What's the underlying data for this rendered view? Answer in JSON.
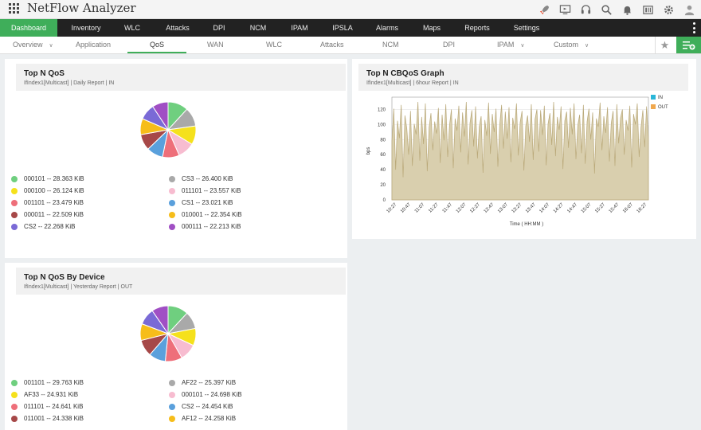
{
  "app": {
    "title": "NetFlow Analyzer"
  },
  "top_icons": [
    "rocket-icon",
    "monitor-icon",
    "headset-icon",
    "search-icon",
    "bell-icon",
    "license-icon",
    "gear-icon",
    "user-icon"
  ],
  "main_nav": [
    {
      "label": "Dashboard",
      "active": true
    },
    {
      "label": "Inventory"
    },
    {
      "label": "WLC"
    },
    {
      "label": "Attacks"
    },
    {
      "label": "DPI"
    },
    {
      "label": "NCM"
    },
    {
      "label": "IPAM"
    },
    {
      "label": "IPSLA"
    },
    {
      "label": "Alarms"
    },
    {
      "label": "Maps"
    },
    {
      "label": "Reports"
    },
    {
      "label": "Settings"
    }
  ],
  "sub_nav": [
    {
      "label": "Overview",
      "dropdown": true
    },
    {
      "label": "Application"
    },
    {
      "label": "QoS",
      "active": true
    },
    {
      "label": "WAN"
    },
    {
      "label": "WLC"
    },
    {
      "label": "Attacks"
    },
    {
      "label": "NCM"
    },
    {
      "label": "DPI"
    },
    {
      "label": "IPAM",
      "dropdown": true
    },
    {
      "label": "Custom",
      "dropdown": true
    }
  ],
  "widgets": {
    "top_qos": {
      "title": "Top N QoS",
      "subtitle": "IfIndex1[Multicast] | Daily Report | IN",
      "items": [
        {
          "label": "000101 -- 28.363 KiB",
          "value": 28.363,
          "color": "#6fcf7f"
        },
        {
          "label": "CS3 -- 26.400 KiB",
          "value": 26.4,
          "color": "#a9a9a9"
        },
        {
          "label": "000100 -- 26.124 KiB",
          "value": 26.124,
          "color": "#f5e11c"
        },
        {
          "label": "011101 -- 23.557 KiB",
          "value": 23.557,
          "color": "#f7bcd0"
        },
        {
          "label": "001101 -- 23.479 KiB",
          "value": 23.479,
          "color": "#ee6f7a"
        },
        {
          "label": "CS1 -- 23.021 KiB",
          "value": 23.021,
          "color": "#5aa0dc"
        },
        {
          "label": "000011 -- 22.509 KiB",
          "value": 22.509,
          "color": "#a64848"
        },
        {
          "label": "010001 -- 22.354 KiB",
          "value": 22.354,
          "color": "#f6bd1a"
        },
        {
          "label": "CS2 -- 22.268 KiB",
          "value": 22.268,
          "color": "#7a6ad6"
        },
        {
          "label": "000111 -- 22.213 KiB",
          "value": 22.213,
          "color": "#a04fc4"
        }
      ]
    },
    "top_qos_device": {
      "title": "Top N QoS By Device",
      "subtitle": "IfIndex1[Multicast] | Yesterday Report | OUT",
      "items": [
        {
          "label": "001101 -- 29.763 KiB",
          "value": 29.763,
          "color": "#6fcf7f"
        },
        {
          "label": "AF22 -- 25.397 KiB",
          "value": 25.397,
          "color": "#a9a9a9"
        },
        {
          "label": "AF33 -- 24.931 KiB",
          "value": 24.931,
          "color": "#f5e11c"
        },
        {
          "label": "000101 -- 24.698 KiB",
          "value": 24.698,
          "color": "#f7bcd0"
        },
        {
          "label": "011101 -- 24.641 KiB",
          "value": 24.641,
          "color": "#ee6f7a"
        },
        {
          "label": "CS2 -- 24.454 KiB",
          "value": 24.454,
          "color": "#5aa0dc"
        },
        {
          "label": "011001 -- 24.338 KiB",
          "value": 24.338,
          "color": "#a64848"
        },
        {
          "label": "AF12 -- 24.258 KiB",
          "value": 24.258,
          "color": "#f6bd1a"
        },
        {
          "label": "",
          "value": 24.2,
          "color": "#7a6ad6"
        },
        {
          "label": "",
          "value": 24.1,
          "color": "#a04fc4"
        }
      ]
    },
    "cbqos": {
      "title": "Top N CBQoS Graph",
      "subtitle": "IfIndex1[Multicast] | 6hour Report | IN"
    }
  },
  "chart_data": {
    "type": "area",
    "title": "Top N CBQoS Graph",
    "xlabel": "Time ( HH:MM )",
    "ylabel": "bps",
    "ylim": [
      0,
      130
    ],
    "yticks": [
      0,
      20,
      40,
      60,
      80,
      100,
      120
    ],
    "x_ticks": [
      "10:27",
      "10:47",
      "11:07",
      "11:27",
      "11:47",
      "12:07",
      "12:27",
      "12:47",
      "13:07",
      "13:27",
      "13:47",
      "14:07",
      "14:27",
      "14:47",
      "15:07",
      "15:27",
      "15:47",
      "16:07",
      "16:27"
    ],
    "legend": "top-right",
    "series": [
      {
        "name": "IN",
        "color": "#29b6d8",
        "values": []
      },
      {
        "name": "OUT",
        "color": "#f0a84e",
        "values": [
          78,
          121,
          40,
          105,
          82,
          126,
          30,
          112,
          95,
          60,
          118,
          45,
          101,
          87,
          130,
          52,
          110,
          74,
          128,
          38,
          96,
          115,
          66,
          104,
          88,
          122,
          49,
          113,
          79,
          127,
          57,
          99,
          120,
          42,
          108,
          92,
          125,
          63,
          116,
          84,
          130,
          47,
          102,
          119,
          71,
          124,
          55,
          97,
          111,
          36,
          106,
          85,
          129,
          61,
          114,
          90,
          121,
          44,
          100,
          126,
          68,
          117,
          81,
          123,
          50,
          109,
          94,
          128,
          59,
          103,
          118,
          39,
          98,
          112,
          77,
          127,
          53,
          107,
          120,
          64,
          119,
          86,
          125,
          46,
          101,
          115,
          73,
          130,
          58,
          110,
          93,
          124,
          41,
          105,
          117,
          69,
          122,
          87,
          128,
          54,
          99,
          113,
          62,
          126,
          48,
          104,
          121,
          80,
          116,
          35,
          108,
          97,
          129,
          66,
          111,
          89,
          123,
          51,
          102,
          118,
          45,
          127,
          75,
          109,
          120,
          60,
          106,
          92,
          125,
          43,
          114,
          100,
          128,
          57,
          96,
          119,
          70,
          124,
          83
        ]
      }
    ]
  }
}
